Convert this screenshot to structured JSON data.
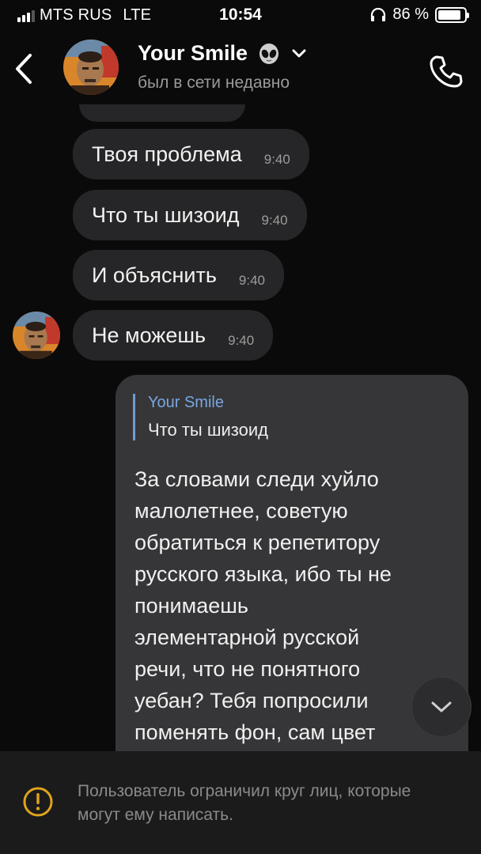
{
  "status_bar": {
    "carrier": "MTS RUS",
    "network": "LTE",
    "time": "10:54",
    "battery": "86 %",
    "battery_level": 0.86
  },
  "header": {
    "back_icon": "chevron-left-icon",
    "name": "Your Smile",
    "name_emoji": "alien-icon",
    "last_seen": "был в сети недавно",
    "call_icon": "phone-icon"
  },
  "messages": [
    {
      "text": "Твоя проблема",
      "time": "9:40"
    },
    {
      "text": "Что ты шизоид",
      "time": "9:40"
    },
    {
      "text": "И объяснить",
      "time": "9:40"
    },
    {
      "text": "Не можешь",
      "time": "9:40"
    }
  ],
  "outgoing": {
    "reply_author": "Your Smile",
    "reply_text": "Что ты шизоид",
    "lines": [
      "За словами следи хуйло",
      "малолетнее, советую",
      "обратиться к репетитору",
      "русского языка, ибо ты не",
      "понимаешь",
      "элементарной русской",
      "речи, что не понятного",
      "уебан? Тебя попросили",
      "поменять фон, сам цвет"
    ]
  },
  "footer": {
    "warning_icon": "warning-circle-icon",
    "notice": "Пользователь ограничил круг лиц, которые могут ему написать."
  },
  "colors": {
    "background": "#0a0a0a",
    "incoming_bubble": "#262628",
    "outgoing_bubble": "#363638",
    "accent": "#7aa7e0",
    "warning": "#e0a31a"
  }
}
